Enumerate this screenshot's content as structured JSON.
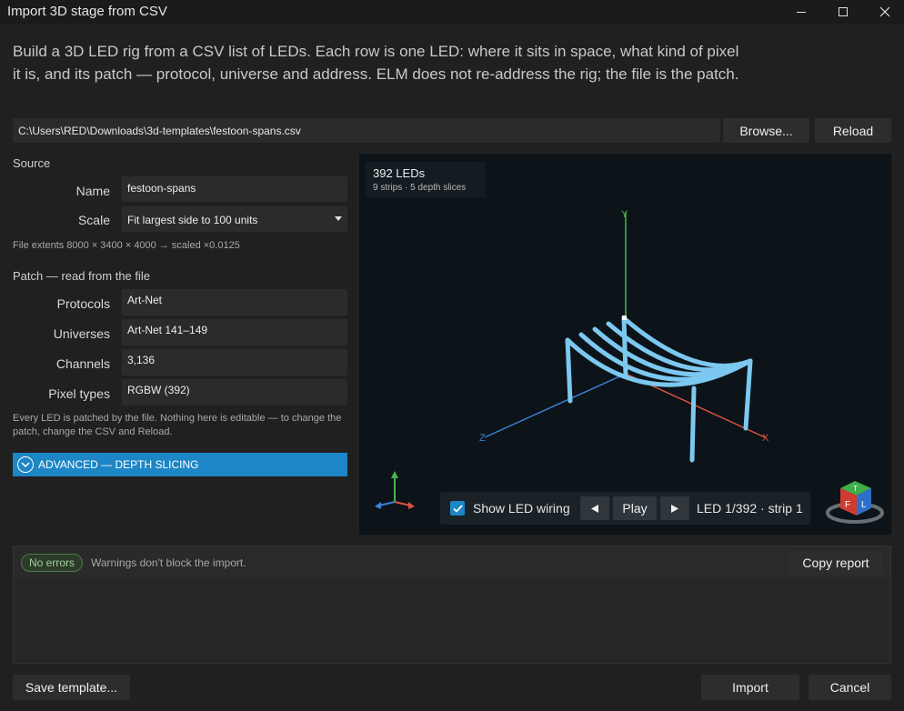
{
  "window": {
    "title": "Import 3D stage from CSV"
  },
  "intro": {
    "text": "Build a 3D LED rig from a CSV list of LEDs. Each row is one LED: where it sits in space, what kind of pixel it is, and its patch — protocol, universe and address. ELM does not re-address the rig; the file is the patch."
  },
  "file": {
    "path": "C:\\Users\\RED\\Downloads\\3d-templates\\festoon-spans.csv",
    "browse_label": "Browse...",
    "reload_label": "Reload"
  },
  "source": {
    "heading": "Source",
    "name_label": "Name",
    "name_value": "festoon-spans",
    "scale_label": "Scale",
    "scale_value": "Fit largest side to 100 units",
    "extents": "File extents 8000 × 3400 × 4000 → scaled ×0.0125"
  },
  "patch": {
    "heading": "Patch — read from the file",
    "protocols_label": "Protocols",
    "protocols_value": "Art-Net",
    "universes_label": "Universes",
    "universes_value": "Art-Net 141–149",
    "channels_label": "Channels",
    "channels_value": "3,136",
    "pixel_label": "Pixel types",
    "pixel_value": "RGBW (392)",
    "note": "Every LED is patched by the file. Nothing here is editable — to change the patch, change the CSV and Reload."
  },
  "advanced": {
    "label": "ADVANCED — DEPTH SLICING"
  },
  "viewport": {
    "led_count": "392 LEDs",
    "details": "9 strips · 5 depth slices",
    "axis_y": "Y",
    "axis_x": "X",
    "axis_z": "Z",
    "show_wiring_label": "Show LED wiring",
    "show_wiring_checked": true,
    "play_label": "Play",
    "led_status": "LED 1/392 · strip 1",
    "cube_face_front": "F",
    "cube_face_left": "L",
    "cube_face_top": "T"
  },
  "report": {
    "status_badge": "No errors",
    "status_text": "Warnings don't block the import.",
    "copy_label": "Copy report"
  },
  "footer": {
    "save_label": "Save template...",
    "import_label": "Import",
    "cancel_label": "Cancel"
  },
  "colors": {
    "accent": "#1c86c6",
    "led": "#7cc8f0",
    "axis_x": "#d9543f",
    "axis_y": "#47b44a",
    "axis_z": "#3b82d6"
  }
}
